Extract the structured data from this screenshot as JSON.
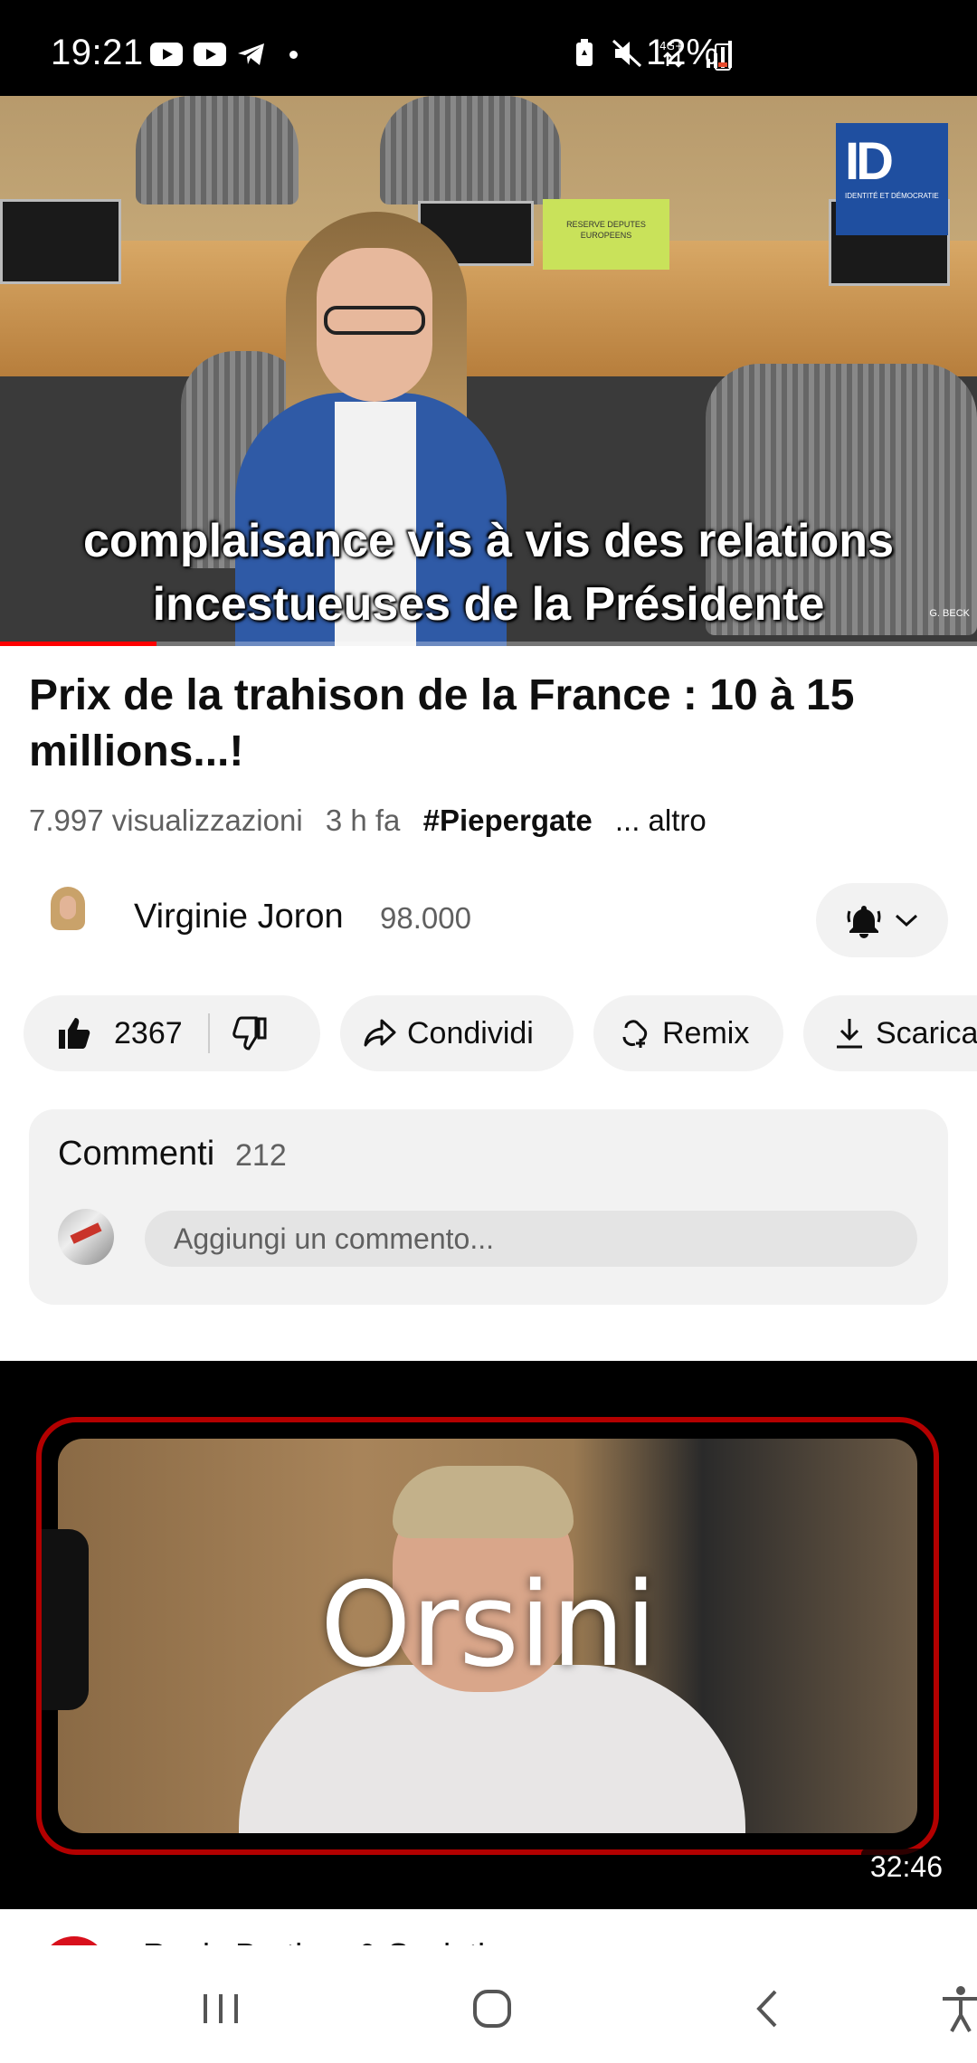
{
  "status_bar": {
    "time": "19:21",
    "battery": "12%",
    "icons": [
      "youtube-icon",
      "youtube-icon",
      "telegram-icon",
      "dot-icon",
      "battery-saver-icon",
      "mute-icon",
      "network-4g-icon",
      "signal-icon",
      "battery-icon"
    ]
  },
  "player": {
    "subtitle_line1": "complaisance vis à vis des relations",
    "subtitle_line2": "incestueuses de la Présidente",
    "sign_text": "RESERVE DEPUTES EUROPEENS",
    "logo_text": "ID",
    "logo_subtext": "IDENTITÉ ET DÉMOCRATIE",
    "watermark": "G. BECK",
    "progress_fraction": 0.16,
    "progress_color": "#ff0000"
  },
  "video": {
    "title": "Prix de la trahison de la France : 10 à 15 millions...!",
    "views": "7.997 visualizzazioni",
    "age": "3 h fa",
    "hashtag": "#Piepergate",
    "more": "... altro"
  },
  "channel": {
    "name": "Virginie Joron",
    "subscribers": "98.000",
    "bell_icon": "bell-icon"
  },
  "actions": {
    "likes": "2367",
    "share": "Condividi",
    "remix": "Remix",
    "download": "Scarica"
  },
  "comments": {
    "title": "Commenti",
    "count": "212",
    "placeholder": "Aggiungi un commento..."
  },
  "next_video": {
    "thumbnail_text": "Orsini",
    "duration": "32:46",
    "frame_color": "#b30000"
  },
  "partial_row": {
    "text": "Regis Barthes & Sovieticus"
  },
  "nav": {
    "icons": [
      "recent-apps-icon",
      "home-icon",
      "back-icon",
      "accessibility-icon"
    ]
  }
}
